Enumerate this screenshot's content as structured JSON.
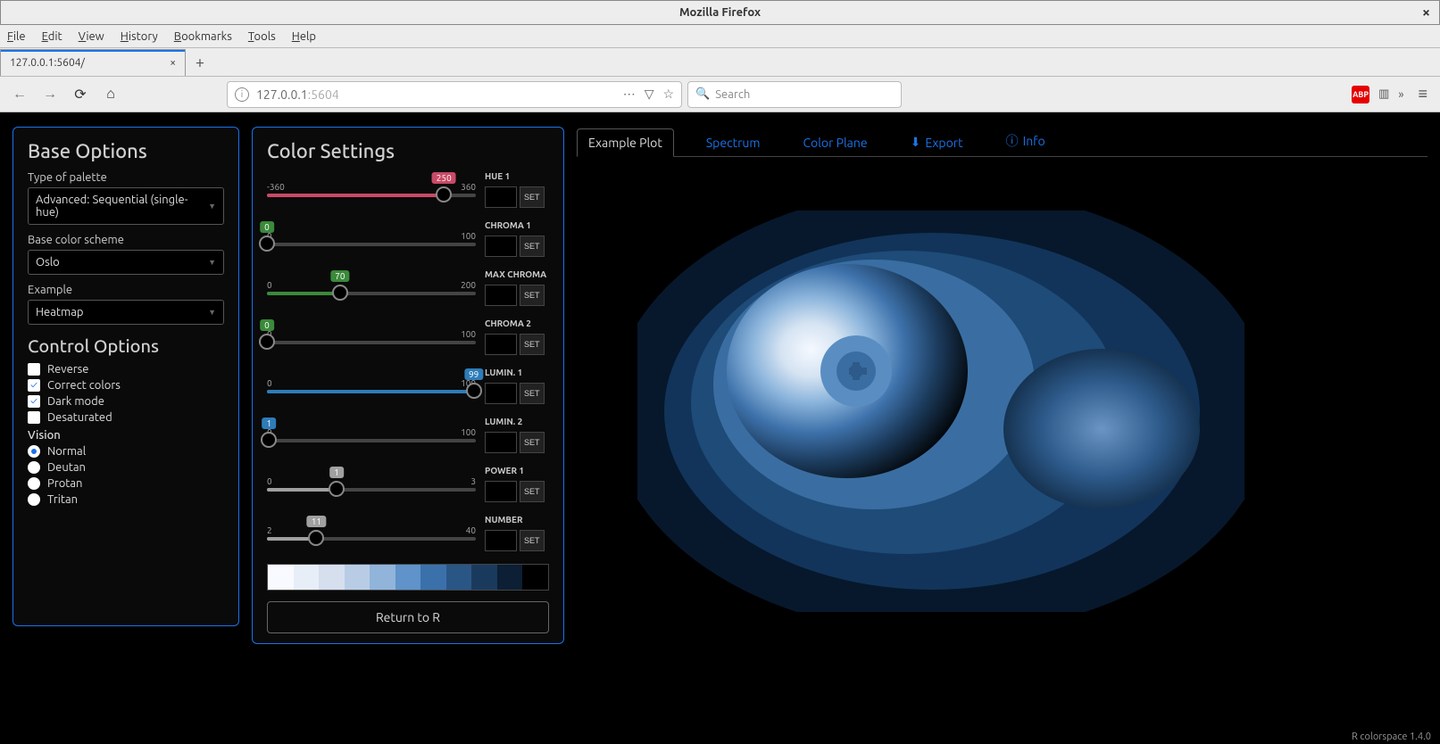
{
  "window": {
    "title": "Mozilla Firefox"
  },
  "browser": {
    "menu": [
      "File",
      "Edit",
      "View",
      "History",
      "Bookmarks",
      "Tools",
      "Help"
    ],
    "tab_title": "127.0.0.1:5604/",
    "url_display_prefix": "127.0.0.1",
    "url_display_suffix": ":5604",
    "search_placeholder": "Search",
    "abp": "ABP"
  },
  "base_options": {
    "heading": "Base Options",
    "palette_type_label": "Type of palette",
    "palette_type_value": "Advanced: Sequential (single-hue)",
    "scheme_label": "Base color scheme",
    "scheme_value": "Oslo",
    "example_label": "Example",
    "example_value": "Heatmap"
  },
  "control_options": {
    "heading": "Control Options",
    "reverse": "Reverse",
    "correct": "Correct colors",
    "dark": "Dark mode",
    "desat": "Desaturated",
    "vision_label": "Vision",
    "vision": [
      "Normal",
      "Deutan",
      "Protan",
      "Tritan"
    ],
    "checked": {
      "reverse": false,
      "correct": true,
      "dark": true,
      "desat": false
    },
    "vision_selected": "Normal"
  },
  "color_settings": {
    "heading": "Color Settings",
    "set_label": "SET",
    "return_label": "Return to R",
    "sliders": [
      {
        "min": -360,
        "max": 360,
        "val": 250,
        "label": "HUE 1",
        "color": "#c94a66"
      },
      {
        "min": 0,
        "max": 100,
        "val": 0,
        "label": "CHROMA 1",
        "color": "#3a8a3a"
      },
      {
        "min": 0,
        "max": 200,
        "val": 70,
        "label": "MAX CHROMA",
        "color": "#3a8a3a"
      },
      {
        "min": 0,
        "max": 100,
        "val": 0,
        "label": "CHROMA 2",
        "color": "#3a8a3a"
      },
      {
        "min": 0,
        "max": 100,
        "val": 99,
        "label": "LUMIN. 1",
        "color": "#2e7cb8"
      },
      {
        "min": 0,
        "max": 100,
        "val": 1,
        "label": "LUMIN. 2",
        "color": "#2e7cb8"
      },
      {
        "min": 0,
        "max": 3,
        "val": 1,
        "label": "POWER 1",
        "color": "#a0a0a0"
      },
      {
        "min": 2,
        "max": 40,
        "val": 11,
        "label": "NUMBER",
        "color": "#a0a0a0"
      }
    ],
    "palette": [
      "#f8faff",
      "#e8eef7",
      "#d5dfee",
      "#b8cde5",
      "#91b4db",
      "#5f93c9",
      "#3b71ab",
      "#2a5686",
      "#1a3a5d",
      "#0c1f34",
      "#000000"
    ]
  },
  "tabs": {
    "items": [
      "Example Plot",
      "Spectrum",
      "Color Plane",
      "Export",
      "Info"
    ],
    "active": "Example Plot"
  },
  "footer": "R colorspace 1.4.0"
}
